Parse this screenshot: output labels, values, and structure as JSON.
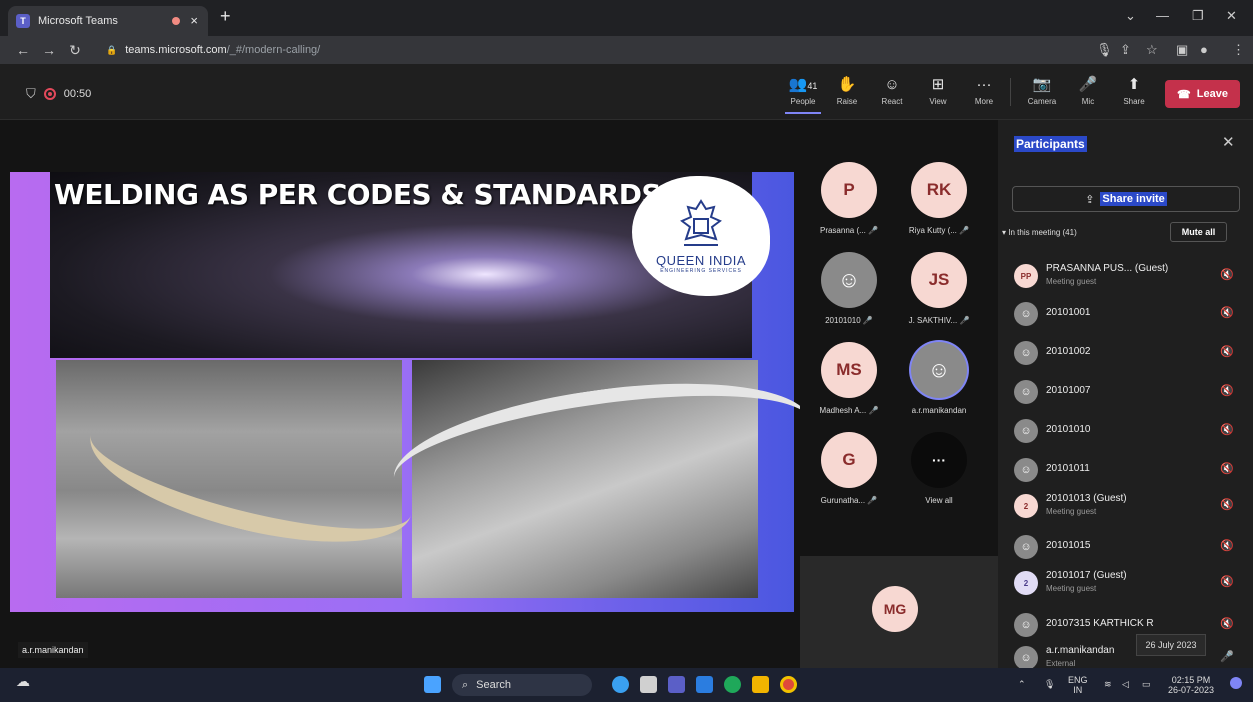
{
  "browser": {
    "tab_title": "Microsoft Teams",
    "tab_close": "×",
    "new_tab": "+",
    "url_host": "teams.microsoft.com",
    "url_path": "/_#/modern-calling/",
    "win_min": "—",
    "win_restore": "❐",
    "win_close": "✕"
  },
  "meeting": {
    "timer": "00:50",
    "people_count": "41",
    "toolbar": [
      {
        "label": "People",
        "icon": "👥"
      },
      {
        "label": "Raise",
        "icon": "✋"
      },
      {
        "label": "React",
        "icon": "☺"
      },
      {
        "label": "View",
        "icon": "⊞"
      },
      {
        "label": "More",
        "icon": "···"
      },
      {
        "label": "Camera",
        "icon": "📷"
      },
      {
        "label": "Mic",
        "icon": "🎤"
      },
      {
        "label": "Share",
        "icon": "⬆"
      }
    ],
    "leave_label": "Leave"
  },
  "slide": {
    "title": "WELDING AS PER CODES & STANDARDS",
    "logo_name": "QUEEN INDIA",
    "logo_sub": "ENGINEERING SERVICES"
  },
  "presenter_name": "a.r.manikandan",
  "gallery": [
    {
      "initials": "P",
      "name": "Prasanna (..."
    },
    {
      "initials": "RK",
      "name": "Riya Kutty (..."
    },
    {
      "initials": "",
      "name": "20101010"
    },
    {
      "initials": "JS",
      "name": "J. SAKTHIV..."
    },
    {
      "initials": "MS",
      "name": "Madhesh A..."
    },
    {
      "initials": "",
      "name": "a.r.manikandan"
    },
    {
      "initials": "G",
      "name": "Gurunatha..."
    },
    {
      "initials": "···",
      "name": "View all"
    }
  ],
  "spotlight_initials": "MG",
  "panel": {
    "title": "Participants",
    "share_invite": "Share invite",
    "in_meeting": "In this meeting (41)",
    "mute_all": "Mute all",
    "participants": [
      {
        "avatar": "PP",
        "name": "PRASANNA PUS... (Guest)",
        "sub": "Meeting guest"
      },
      {
        "avatar": "",
        "name": "20101001",
        "sub": ""
      },
      {
        "avatar": "",
        "name": "20101002",
        "sub": ""
      },
      {
        "avatar": "",
        "name": "20101007",
        "sub": ""
      },
      {
        "avatar": "",
        "name": "20101010",
        "sub": ""
      },
      {
        "avatar": "",
        "name": "20101011",
        "sub": ""
      },
      {
        "avatar": "2",
        "name": "20101013 (Guest)",
        "sub": "Meeting guest"
      },
      {
        "avatar": "",
        "name": "20101015",
        "sub": ""
      },
      {
        "avatar": "2",
        "name": "20101017 (Guest)",
        "sub": "Meeting guest"
      },
      {
        "avatar": "",
        "name": "20107315 KARTHICK R",
        "sub": ""
      },
      {
        "avatar": "",
        "name": "a.r.manikandan",
        "sub": "External"
      }
    ],
    "date_tooltip": "26 July 2023"
  },
  "taskbar": {
    "search": "Search",
    "lang": "ENG",
    "region": "IN",
    "time": "02:15 PM",
    "date": "26-07-2023"
  },
  "colors": {
    "leave": "#c4314b",
    "accent": "#7f85f5",
    "highlight": "#2b49c8"
  }
}
